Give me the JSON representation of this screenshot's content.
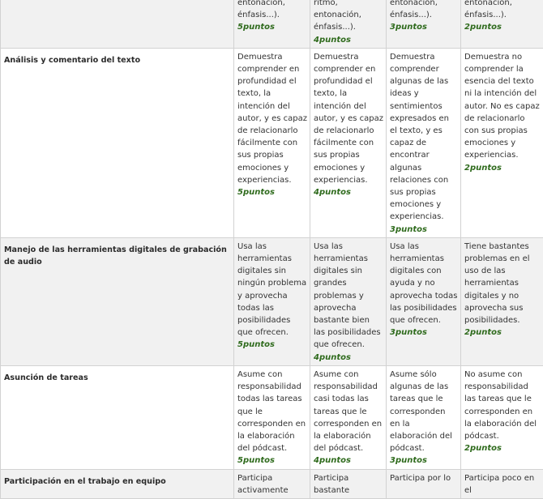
{
  "rows": [
    {
      "criterion": "",
      "cells": [
        {
          "text": "entonación, énfasis...).",
          "points": "5puntos"
        },
        {
          "text": "ritmo, entonación, énfasis...).",
          "points": "4puntos"
        },
        {
          "text": "entonación, énfasis...).",
          "points": "3puntos"
        },
        {
          "text": "entonación, énfasis...).",
          "points": "2puntos"
        }
      ]
    },
    {
      "criterion": "Análisis y comentario del texto",
      "cells": [
        {
          "text": "Demuestra comprender en profundidad el texto, la intención del autor, y es capaz de relacionarlo fácilmente con sus propias emociones y experiencias.",
          "points": "5puntos"
        },
        {
          "text": "Demuestra comprender en profundidad el texto, la intención del autor, y es capaz de relacionarlo fácilmente con sus propias emociones y experiencias.",
          "points": "4puntos"
        },
        {
          "text": "Demuestra comprender algunas de las ideas y sentimientos expresados en el texto, y es capaz de encontrar algunas relaciones con sus propias emociones y experiencias.",
          "points": "3puntos"
        },
        {
          "text": "Demuestra no comprender la esencia del texto ni la intención del autor. No es capaz de relacionarlo con sus propias emociones y experiencias.",
          "points": "2puntos"
        }
      ]
    },
    {
      "criterion": "Manejo de las herramientas digitales de grabación de audio",
      "cells": [
        {
          "text": "Usa las herramientas digitales sin ningún problema y aprovecha todas las posibilidades que ofrecen.",
          "points": "5puntos"
        },
        {
          "text": "Usa las herramientas digitales sin grandes problemas y aprovecha bastante bien las posibilidades que ofrecen.",
          "points": "4puntos"
        },
        {
          "text": "Usa las herramientas digitales con ayuda y no aprovecha todas las posibilidades que ofrecen.",
          "points": "3puntos"
        },
        {
          "text": "Tiene bastantes problemas en el uso de las herramientas digitales y no aprovecha sus posibilidades.",
          "points": "2puntos"
        }
      ]
    },
    {
      "criterion": "Asunción de tareas",
      "cells": [
        {
          "text": "Asume con responsabilidad todas las tareas que le corresponden en la elaboración del pódcast.",
          "points": "5puntos"
        },
        {
          "text": "Asume con responsabilidad casi todas las tareas que le corresponden en la elaboración del pódcast.",
          "points": "4puntos"
        },
        {
          "text": "Asume sólo algunas de las tareas que le corresponden en la elaboración del pódcast.",
          "points": "3puntos"
        },
        {
          "text": "No asume con responsabilidad las tareas que le corresponden en la elaboración del pódcast.",
          "points": "2puntos"
        }
      ]
    },
    {
      "criterion": "Participación en el trabajo en equipo",
      "cells": [
        {
          "text": "Participa activamente",
          "points": ""
        },
        {
          "text": "Participa bastante",
          "points": ""
        },
        {
          "text": "Participa por lo",
          "points": ""
        },
        {
          "text": "Participa poco en el",
          "points": ""
        }
      ]
    }
  ]
}
